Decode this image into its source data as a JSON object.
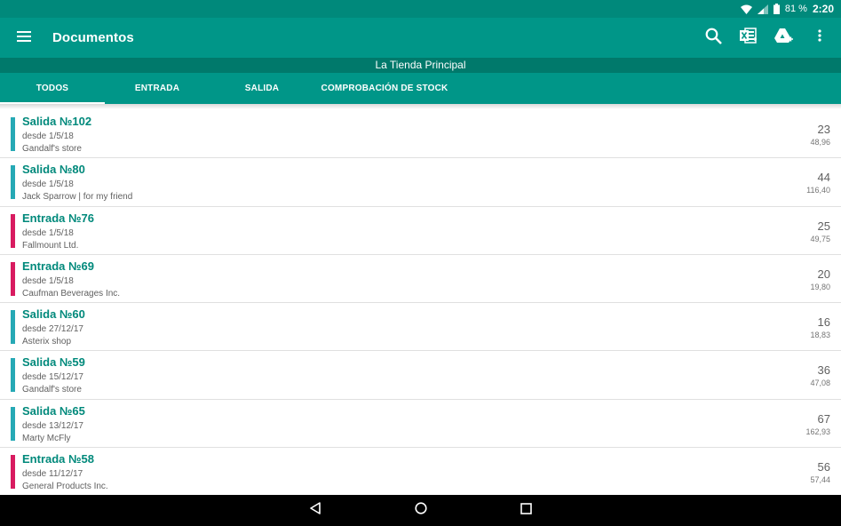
{
  "status_bar": {
    "battery": "81 %",
    "time": "2:20"
  },
  "app_bar": {
    "title": "Documentos",
    "icons": [
      "menu-icon",
      "search-icon",
      "excel-export-icon",
      "drive-add-icon",
      "more-vert-icon"
    ]
  },
  "store": {
    "name": "La Tienda Principal"
  },
  "tabs": [
    {
      "label": "TODOS",
      "active": true
    },
    {
      "label": "ENTRADA",
      "active": false
    },
    {
      "label": "SALIDA",
      "active": false
    },
    {
      "label": "COMPROBACIÓN DE STOCK",
      "active": false
    }
  ],
  "colors": {
    "primary": "#009688",
    "primary_dark": "#00796b",
    "salida": "#26a9b5",
    "entrada": "#d81b60"
  },
  "documents": [
    {
      "type": "salida",
      "title": "Salida №102",
      "date": "desde 1/5/18",
      "party": "Gandalf's store",
      "qty": "23",
      "amount": "48,96"
    },
    {
      "type": "salida",
      "title": "Salida №80",
      "date": "desde 1/5/18",
      "party": "Jack Sparrow  | for my friend",
      "qty": "44",
      "amount": "116,40"
    },
    {
      "type": "entrada",
      "title": "Entrada №76",
      "date": "desde 1/5/18",
      "party": "Fallmount Ltd.",
      "qty": "25",
      "amount": "49,75"
    },
    {
      "type": "entrada",
      "title": "Entrada №69",
      "date": "desde 1/5/18",
      "party": "Caufman Beverages Inc.",
      "qty": "20",
      "amount": "19,80"
    },
    {
      "type": "salida",
      "title": "Salida №60",
      "date": "desde 27/12/17",
      "party": "Asterix shop",
      "qty": "16",
      "amount": "18,83"
    },
    {
      "type": "salida",
      "title": "Salida №59",
      "date": "desde 15/12/17",
      "party": "Gandalf's store",
      "qty": "36",
      "amount": "47,08"
    },
    {
      "type": "salida",
      "title": "Salida №65",
      "date": "desde 13/12/17",
      "party": "Marty McFly",
      "qty": "67",
      "amount": "162,93"
    },
    {
      "type": "entrada",
      "title": "Entrada №58",
      "date": "desde 11/12/17",
      "party": "General Products Inc.",
      "qty": "56",
      "amount": "57,44"
    }
  ]
}
